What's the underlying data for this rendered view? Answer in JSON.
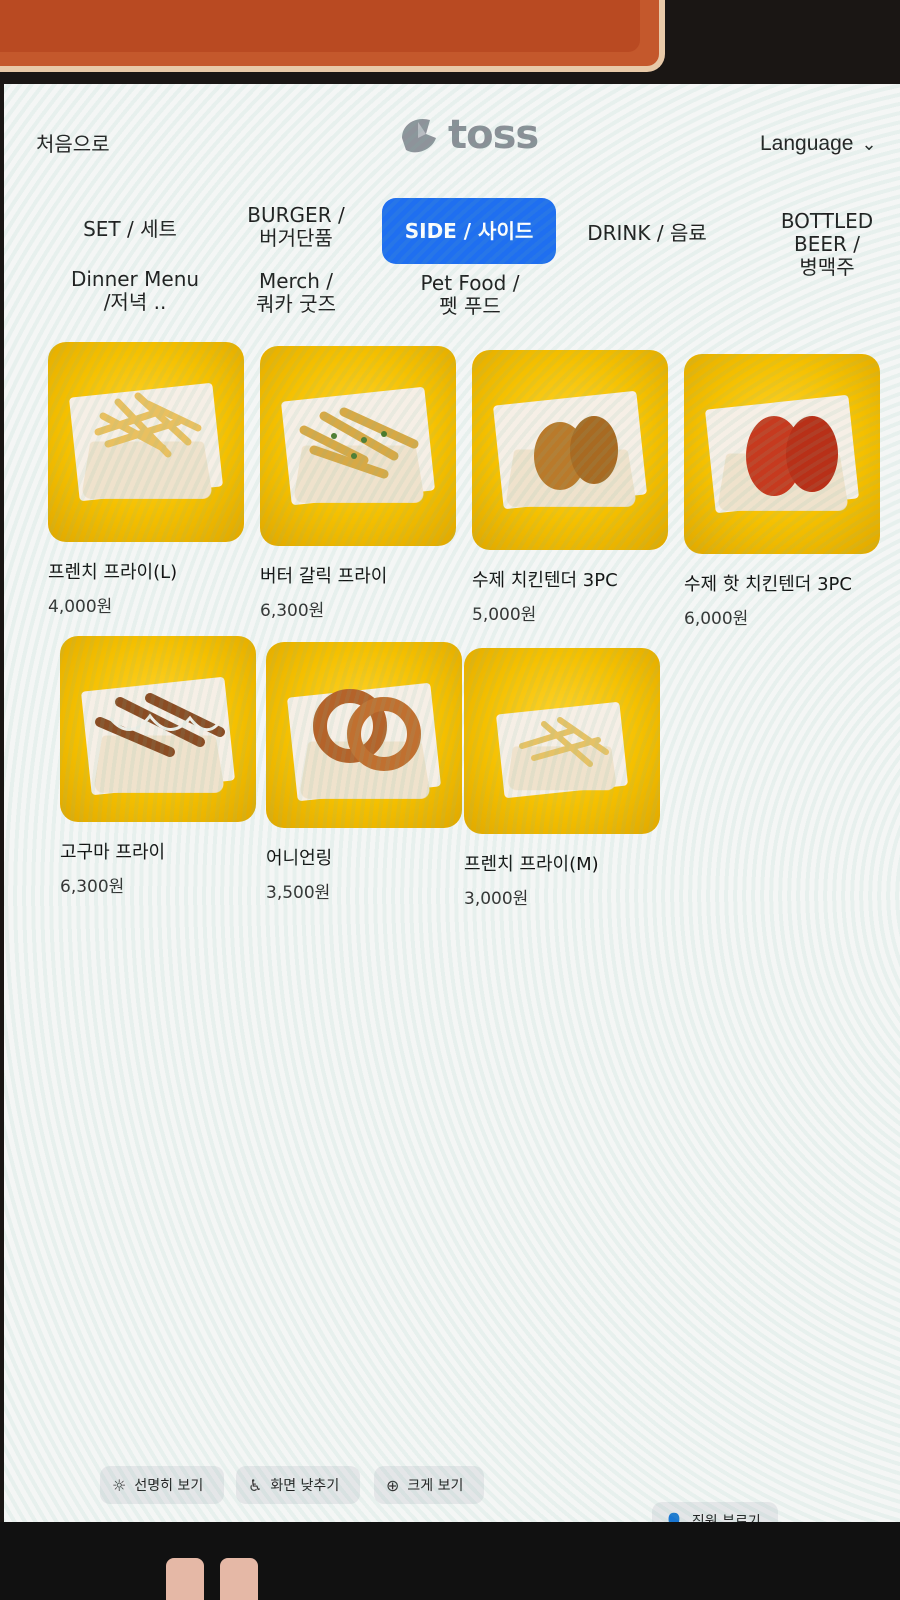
{
  "header": {
    "home_label": "처음으로",
    "logo_text": "toss",
    "language_label": "Language",
    "language_icon": "chevron-down-icon"
  },
  "categories": [
    {
      "label": "SET / 세트",
      "active": false
    },
    {
      "label": "BURGER / 버거단품",
      "active": false
    },
    {
      "label": "SIDE / 사이드",
      "active": true
    },
    {
      "label": "DRINK / 음료",
      "active": false
    },
    {
      "label": "BOTTLED BEER / 병맥주",
      "active": false
    },
    {
      "label": "Dinner Menu /저녁 ..",
      "active": false
    },
    {
      "label": "Merch / 쿼카 굿즈",
      "active": false
    },
    {
      "label": "Pet Food / 펫 푸드",
      "active": false
    }
  ],
  "products": [
    {
      "name": "프렌치 프라이(L)",
      "price": "4,000원"
    },
    {
      "name": "버터 갈릭 프라이",
      "price": "6,300원"
    },
    {
      "name": "수제 치킨텐더 3PC",
      "price": "5,000원"
    },
    {
      "name": "수제 핫 치킨텐더 3PC",
      "price": "6,000원"
    },
    {
      "name": "고구마 프라이",
      "price": "6,300원"
    },
    {
      "name": "어니언링",
      "price": "3,500원"
    },
    {
      "name": "프렌치 프라이(M)",
      "price": "3,000원"
    }
  ],
  "footer": {
    "brightness": "선명히 보기",
    "lower_screen": "화면 낮추기",
    "zoom": "크게 보기",
    "call_staff": "직원 부르기"
  },
  "colors": {
    "accent": "#1f6ff0",
    "card_bg": "#f5c000",
    "screen_bg": "#f4f6f5"
  }
}
